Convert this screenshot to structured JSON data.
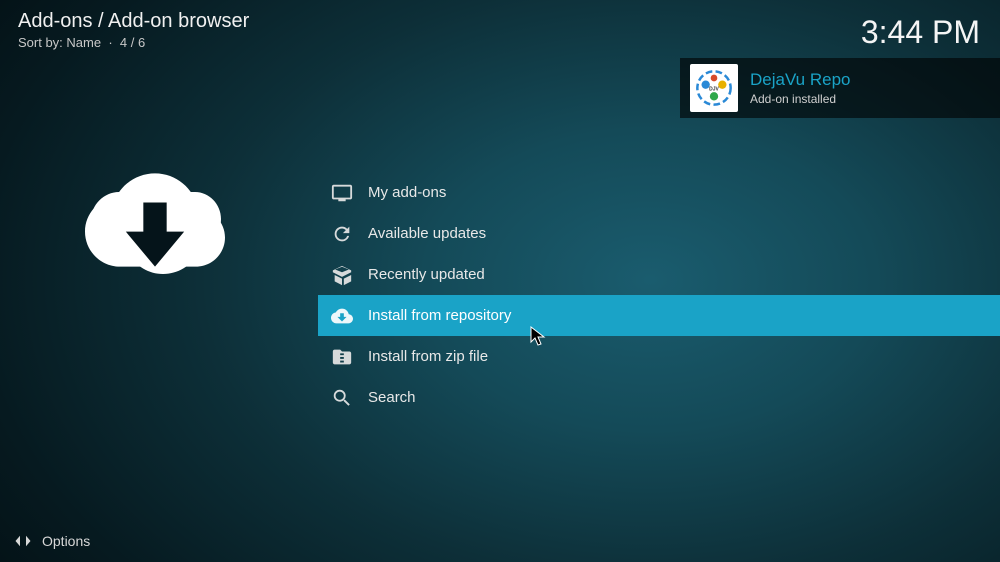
{
  "header": {
    "breadcrumb": "Add-ons / Add-on browser",
    "sort_label": "Sort by:",
    "sort_value": "Name",
    "position": "4 / 6"
  },
  "clock": "3:44 PM",
  "menu": [
    {
      "icon": "tv-icon",
      "label": "My add-ons",
      "selected": false
    },
    {
      "icon": "refresh-icon",
      "label": "Available updates",
      "selected": false
    },
    {
      "icon": "box-open-icon",
      "label": "Recently updated",
      "selected": false
    },
    {
      "icon": "cloud-download-icon",
      "label": "Install from repository",
      "selected": true
    },
    {
      "icon": "zip-icon",
      "label": "Install from zip file",
      "selected": false
    },
    {
      "icon": "search-icon",
      "label": "Search",
      "selected": false
    }
  ],
  "notification": {
    "title": "DejaVu Repo",
    "subtitle": "Add-on installed"
  },
  "footer": {
    "options": "Options"
  }
}
